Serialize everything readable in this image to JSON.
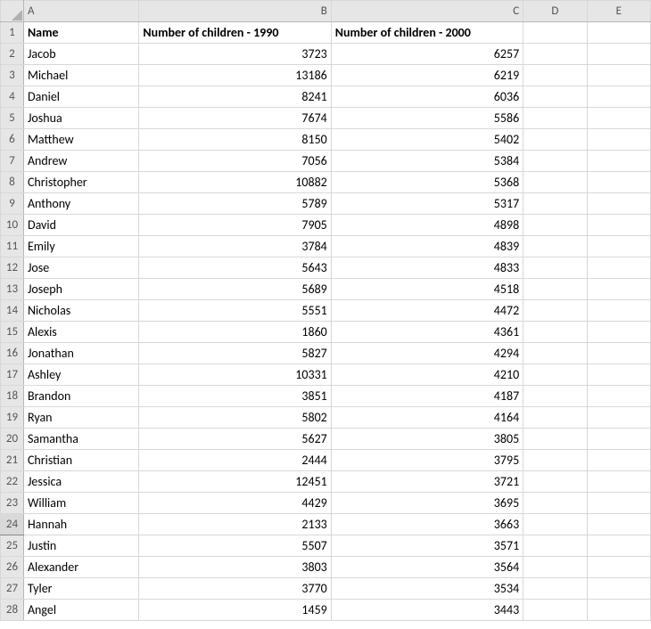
{
  "columns": [
    "A",
    "B",
    "C",
    "D",
    "E"
  ],
  "headers": {
    "A": "Name",
    "B": "Number of children - 1990",
    "C": "Number of children - 2000"
  },
  "selected_row": 24,
  "rows": [
    {
      "n": 2,
      "name": "Jacob",
      "v1990": "3723",
      "v2000": "6257"
    },
    {
      "n": 3,
      "name": "Michael",
      "v1990": "13186",
      "v2000": "6219"
    },
    {
      "n": 4,
      "name": "Daniel",
      "v1990": "8241",
      "v2000": "6036"
    },
    {
      "n": 5,
      "name": "Joshua",
      "v1990": "7674",
      "v2000": "5586"
    },
    {
      "n": 6,
      "name": "Matthew",
      "v1990": "8150",
      "v2000": "5402"
    },
    {
      "n": 7,
      "name": "Andrew",
      "v1990": "7056",
      "v2000": "5384"
    },
    {
      "n": 8,
      "name": "Christopher",
      "v1990": "10882",
      "v2000": "5368"
    },
    {
      "n": 9,
      "name": "Anthony",
      "v1990": "5789",
      "v2000": "5317"
    },
    {
      "n": 10,
      "name": "David",
      "v1990": "7905",
      "v2000": "4898"
    },
    {
      "n": 11,
      "name": "Emily",
      "v1990": "3784",
      "v2000": "4839"
    },
    {
      "n": 12,
      "name": "Jose",
      "v1990": "5643",
      "v2000": "4833"
    },
    {
      "n": 13,
      "name": "Joseph",
      "v1990": "5689",
      "v2000": "4518"
    },
    {
      "n": 14,
      "name": "Nicholas",
      "v1990": "5551",
      "v2000": "4472"
    },
    {
      "n": 15,
      "name": "Alexis",
      "v1990": "1860",
      "v2000": "4361"
    },
    {
      "n": 16,
      "name": "Jonathan",
      "v1990": "5827",
      "v2000": "4294"
    },
    {
      "n": 17,
      "name": "Ashley",
      "v1990": "10331",
      "v2000": "4210"
    },
    {
      "n": 18,
      "name": "Brandon",
      "v1990": "3851",
      "v2000": "4187"
    },
    {
      "n": 19,
      "name": "Ryan",
      "v1990": "5802",
      "v2000": "4164"
    },
    {
      "n": 20,
      "name": "Samantha",
      "v1990": "5627",
      "v2000": "3805"
    },
    {
      "n": 21,
      "name": "Christian",
      "v1990": "2444",
      "v2000": "3795"
    },
    {
      "n": 22,
      "name": "Jessica",
      "v1990": "12451",
      "v2000": "3721"
    },
    {
      "n": 23,
      "name": "William",
      "v1990": "4429",
      "v2000": "3695"
    },
    {
      "n": 24,
      "name": "Hannah",
      "v1990": "2133",
      "v2000": "3663"
    },
    {
      "n": 25,
      "name": "Justin",
      "v1990": "5507",
      "v2000": "3571"
    },
    {
      "n": 26,
      "name": "Alexander",
      "v1990": "3803",
      "v2000": "3564"
    },
    {
      "n": 27,
      "name": "Tyler",
      "v1990": "3770",
      "v2000": "3534"
    },
    {
      "n": 28,
      "name": "Angel",
      "v1990": "1459",
      "v2000": "3443"
    }
  ]
}
